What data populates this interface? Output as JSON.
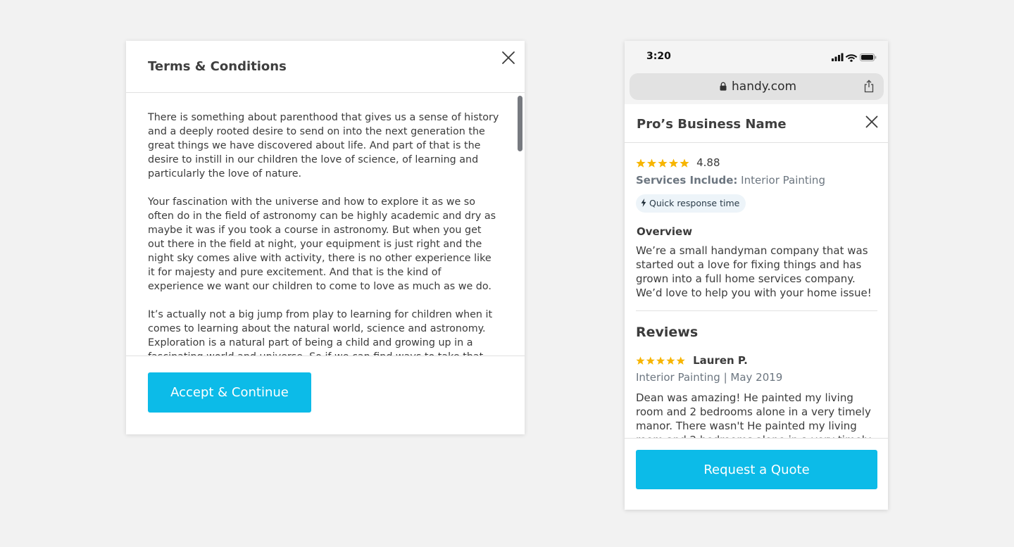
{
  "terms_modal": {
    "title": "Terms & Conditions",
    "close_icon": "close-icon",
    "paragraphs": [
      "There is something about parenthood that gives us a sense of history and a deeply rooted desire to send on into the next generation the great things we have discovered about life. And part of that is the desire to instill in our children the love of science, of learning and particularly the love of nature.",
      "Your fascination with the universe and how to explore it as we so often do in the field of astronomy can be highly academic and dry as maybe it was if you took a course in astronomy. But when you get out there in the field at night, your equipment is just right and the night sky comes alive with activity, there is no other experience like it for majesty and pure excitement. And that is the kind of experience we want our children to come to love as much as we do.",
      "It’s actually not a big jump from play to learning for children when it comes to learning about the natural world, science and astronomy. Exploration is a natural part of being a child and growing up in a fascinating world and universe. So if we can find ways to take that"
    ],
    "accept_label": "Accept & Continue",
    "accent_color": "#0cbbe8"
  },
  "phone": {
    "status_bar": {
      "time": "3:20",
      "icons": [
        "signal-icon",
        "wifi-icon",
        "battery-icon"
      ]
    },
    "browser": {
      "url": "handy.com",
      "icons": [
        "lock-icon",
        "share-icon"
      ]
    },
    "pro": {
      "name": "Pro’s Business Name",
      "rating": "4.88",
      "stars": 5,
      "star_color": "#f7b500",
      "services_label": "Services Include:",
      "services_value": " Interior Painting",
      "badge": "Quick response time",
      "overview_heading": "Overview",
      "overview_text": "We’re a small handyman company that was started out a love for fixing things and has grown into a full home services company. We’d love to help you with your home issue!",
      "reviews_heading": "Reviews",
      "review": {
        "stars": 5,
        "reviewer": "Lauren P.",
        "meta": "Interior Painting | May 2019",
        "text": "Dean was amazing! He painted my living room and 2 bedrooms alone in a very timely manor. There wasn't He painted my living room and 2 bedrooms alone in a very timely manor. There"
      }
    },
    "cta_label": "Request a Quote"
  }
}
